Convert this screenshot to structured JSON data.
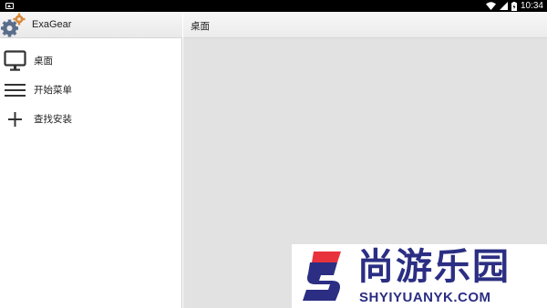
{
  "status_bar": {
    "time": "10:34",
    "icons": [
      "notification-icon",
      "wifi-icon",
      "signal-icon",
      "battery-icon"
    ]
  },
  "sidebar": {
    "app_title": "ExaGear",
    "logo_icon": "gears-icon",
    "items": [
      {
        "label": "桌面",
        "icon": "monitor-icon"
      },
      {
        "label": "开始菜单",
        "icon": "menu-icon"
      },
      {
        "label": "查找安装",
        "icon": "plus-icon"
      }
    ]
  },
  "main": {
    "title": "桌面"
  },
  "watermark": {
    "logo_letter": "S",
    "text": "尚游乐园",
    "url": "SHYIYUANYK.COM",
    "colors": {
      "primary": "#2b2e83",
      "accent": "#e8333c"
    }
  }
}
